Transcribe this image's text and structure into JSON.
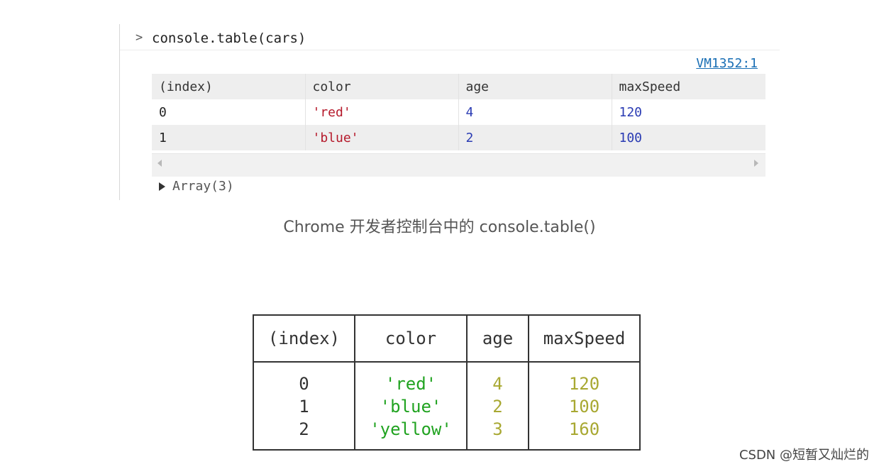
{
  "console": {
    "prompt": ">",
    "command": "console.table(cars)",
    "source_link": "VM1352:1",
    "table": {
      "headers": [
        "(index)",
        "color",
        "age",
        "maxSpeed"
      ],
      "rows": [
        [
          "0",
          "'red'",
          "4",
          "120"
        ],
        [
          "1",
          "'blue'",
          "2",
          "100"
        ]
      ]
    },
    "array_label": "Array(3)"
  },
  "caption": "Chrome 开发者控制台中的 console.table()",
  "terminal_table": {
    "headers": [
      "(index)",
      "color",
      "age",
      "maxSpeed"
    ],
    "rows": [
      [
        "0",
        "'red'",
        "4",
        "120"
      ],
      [
        "1",
        "'blue'",
        "2",
        "100"
      ],
      [
        "2",
        "'yellow'",
        "3",
        "160"
      ]
    ]
  },
  "watermark": "CSDN @短暂又灿烂的",
  "colors": {
    "console_string": "#b5192b",
    "console_number": "#2a3bb3",
    "terminal_string": "#21a321",
    "terminal_number": "#a8a832",
    "link": "#1a6fb5"
  }
}
